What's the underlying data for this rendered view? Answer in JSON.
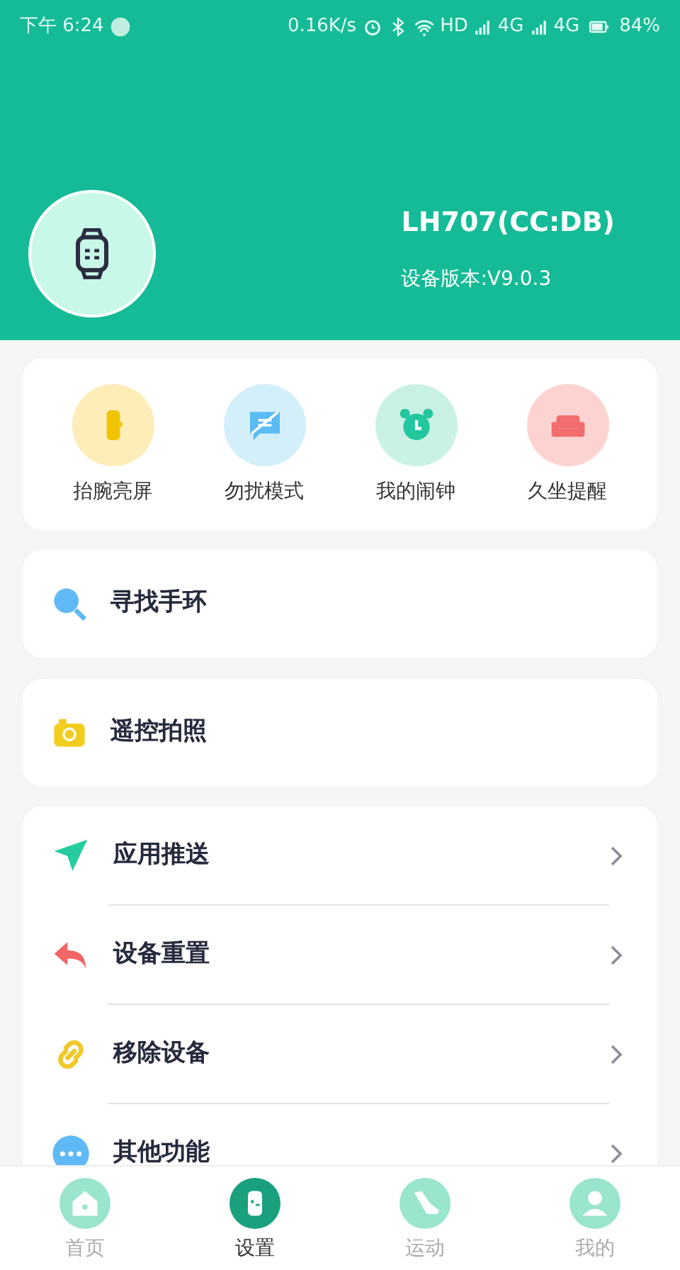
{
  "status_bar": {
    "time": "下午 6:24",
    "speed": "0.16K/s",
    "wifi_label": "HD",
    "sim1": "4G",
    "sim2": "4G",
    "battery": "84%"
  },
  "device": {
    "name": "LH707(CC:DB)",
    "version": "设备版本:V9.0.3"
  },
  "quick_actions": [
    {
      "label": "抬腕亮屏",
      "kind": "wrist",
      "color": "#fdedb8"
    },
    {
      "label": "勿扰模式",
      "kind": "dnd",
      "color": "#d3effa"
    },
    {
      "label": "我的闹钟",
      "kind": "alarm",
      "color": "#c9f2e4"
    },
    {
      "label": "久坐提醒",
      "kind": "sofa",
      "color": "#fdd3d1"
    }
  ],
  "single_cards": [
    {
      "label": "寻找手环",
      "kind": "search"
    },
    {
      "label": "遥控拍照",
      "kind": "camera"
    }
  ],
  "menu": [
    {
      "label": "应用推送",
      "kind": "send"
    },
    {
      "label": "设备重置",
      "kind": "reset"
    },
    {
      "label": "移除设备",
      "kind": "link"
    },
    {
      "label": "其他功能",
      "kind": "more"
    }
  ],
  "tabs": [
    {
      "label": "首页",
      "kind": "home",
      "selected": false
    },
    {
      "label": "设置",
      "kind": "watch",
      "selected": true
    },
    {
      "label": "运动",
      "kind": "shoe",
      "selected": false
    },
    {
      "label": "我的",
      "kind": "person",
      "selected": false
    }
  ]
}
